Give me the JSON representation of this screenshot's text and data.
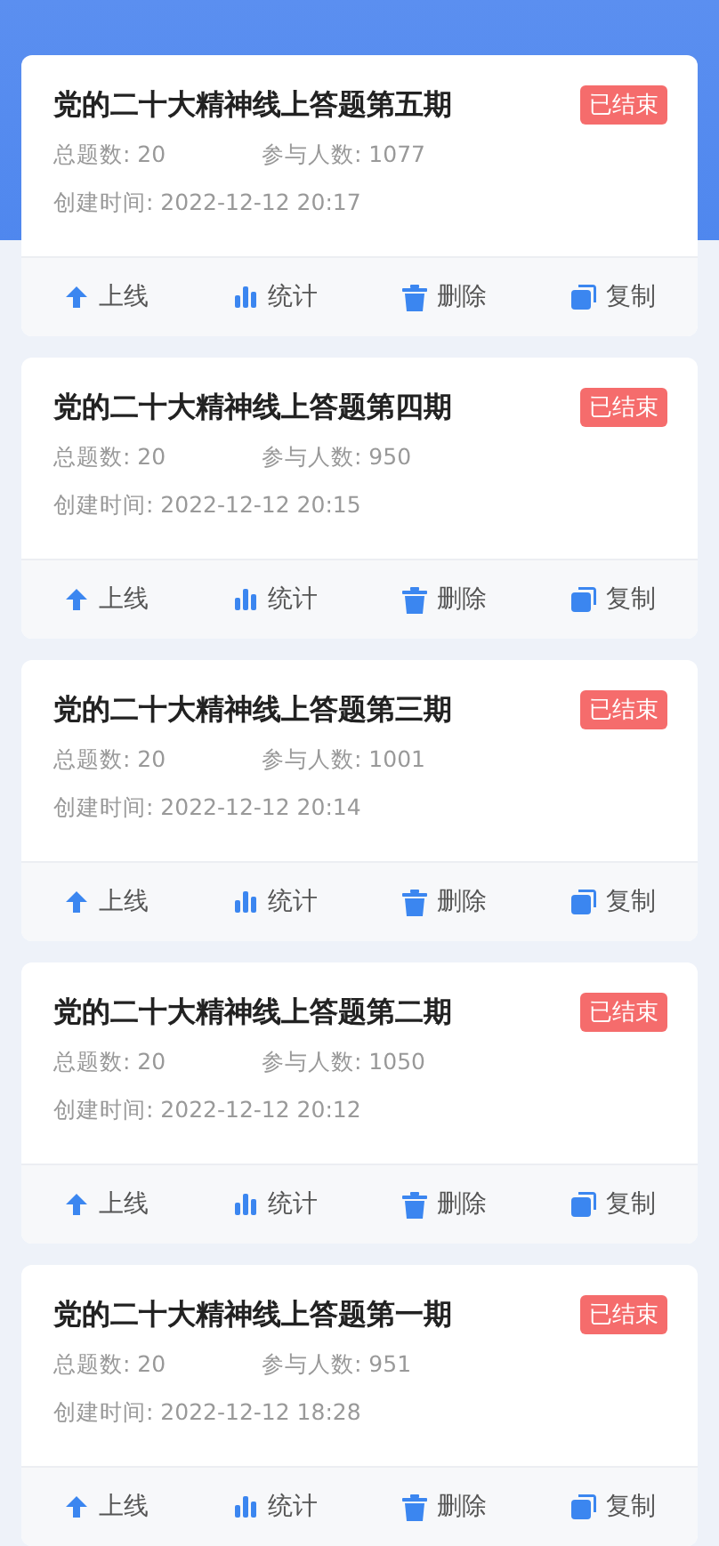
{
  "quizzes": [
    {
      "title": "党的二十大精神线上答题第五期",
      "status": "已结束",
      "total": "总题数: 20",
      "participants": "参与人数: 1077",
      "created": "创建时间: 2022-12-12 20:17",
      "actions": [
        {
          "kind": "online",
          "label": "上线"
        },
        {
          "kind": "stats",
          "label": "统计"
        },
        {
          "kind": "delete",
          "label": "删除"
        },
        {
          "kind": "copy",
          "label": "复制"
        }
      ]
    },
    {
      "title": "党的二十大精神线上答题第四期",
      "status": "已结束",
      "total": "总题数: 20",
      "participants": "参与人数: 950",
      "created": "创建时间: 2022-12-12 20:15",
      "actions": [
        {
          "kind": "online",
          "label": "上线"
        },
        {
          "kind": "stats",
          "label": "统计"
        },
        {
          "kind": "delete",
          "label": "删除"
        },
        {
          "kind": "copy",
          "label": "复制"
        }
      ]
    },
    {
      "title": "党的二十大精神线上答题第三期",
      "status": "已结束",
      "total": "总题数: 20",
      "participants": "参与人数: 1001",
      "created": "创建时间: 2022-12-12 20:14",
      "actions": [
        {
          "kind": "online",
          "label": "上线"
        },
        {
          "kind": "stats",
          "label": "统计"
        },
        {
          "kind": "delete",
          "label": "删除"
        },
        {
          "kind": "copy",
          "label": "复制"
        }
      ]
    },
    {
      "title": "党的二十大精神线上答题第二期",
      "status": "已结束",
      "total": "总题数: 20",
      "participants": "参与人数: 1050",
      "created": "创建时间: 2022-12-12 20:12",
      "actions": [
        {
          "kind": "online",
          "label": "上线"
        },
        {
          "kind": "stats",
          "label": "统计"
        },
        {
          "kind": "delete",
          "label": "删除"
        },
        {
          "kind": "copy",
          "label": "复制"
        }
      ]
    },
    {
      "title": "党的二十大精神线上答题第一期",
      "status": "已结束",
      "total": "总题数: 20",
      "participants": "参与人数: 951",
      "created": "创建时间: 2022-12-12 18:28",
      "actions": [
        {
          "kind": "online",
          "label": "上线"
        },
        {
          "kind": "stats",
          "label": "统计"
        },
        {
          "kind": "delete",
          "label": "删除"
        },
        {
          "kind": "copy",
          "label": "复制"
        }
      ]
    }
  ]
}
